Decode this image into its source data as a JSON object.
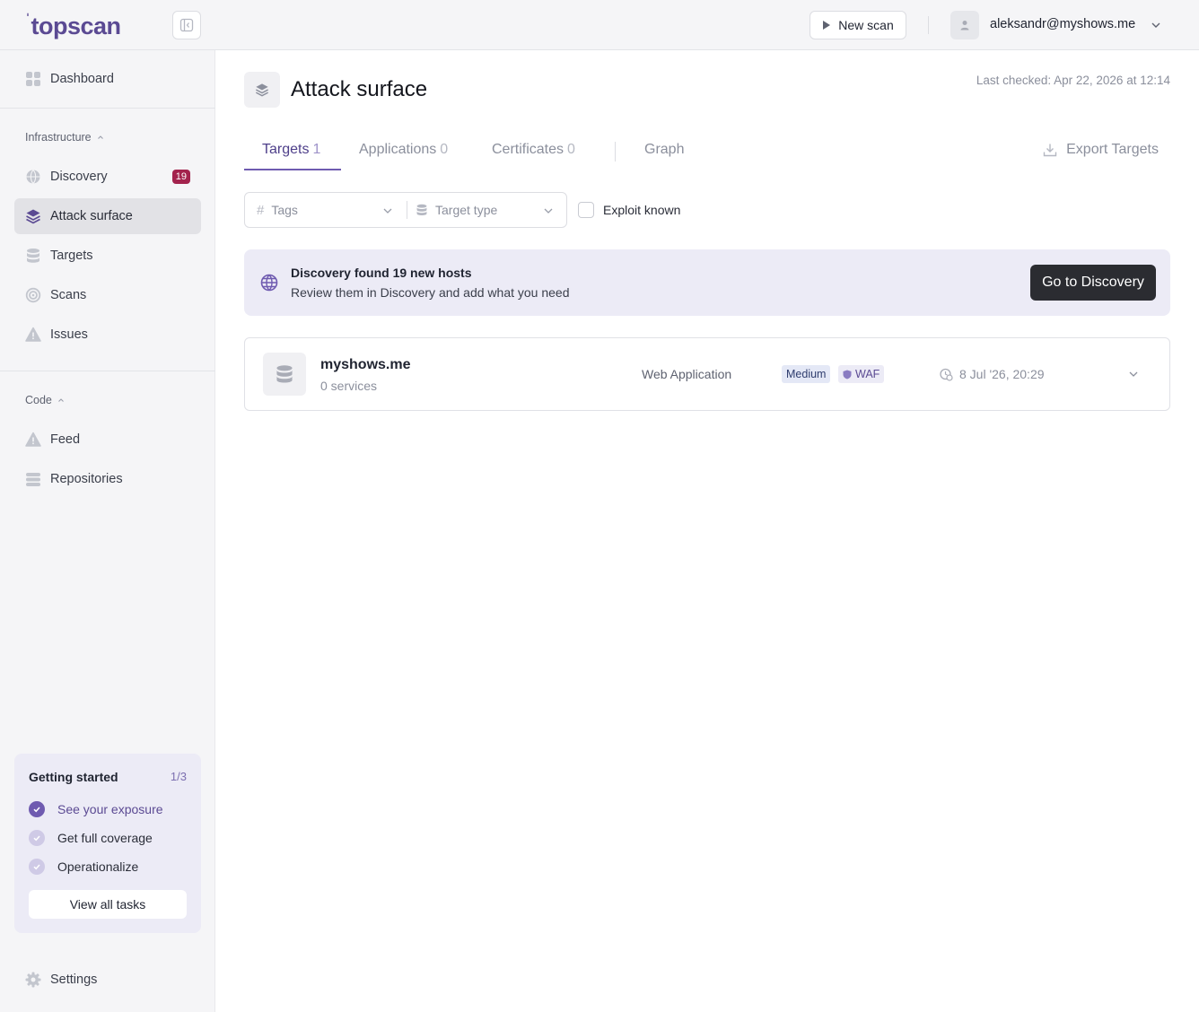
{
  "app": {
    "logo": "topscan",
    "brand_color": "#5b4a93"
  },
  "topbar": {
    "new_scan_label": "New scan",
    "user_email": "aleksandr@myshows.me"
  },
  "sidebar": {
    "dashboard": "Dashboard",
    "infrastructure_label": "Infrastructure",
    "infrastructure_items": [
      {
        "label": "Discovery",
        "icon": "globe-icon",
        "badge": "19"
      },
      {
        "label": "Attack surface",
        "icon": "layers-icon",
        "active": true
      },
      {
        "label": "Targets",
        "icon": "database-icon"
      },
      {
        "label": "Scans",
        "icon": "target-icon"
      },
      {
        "label": "Issues",
        "icon": "warning-icon"
      }
    ],
    "code_label": "Code",
    "code_items": [
      {
        "label": "Feed",
        "icon": "warning-icon"
      },
      {
        "label": "Repositories",
        "icon": "stack-icon"
      }
    ],
    "getting_started": {
      "title": "Getting started",
      "count": "1/3",
      "items": [
        {
          "label": "See your exposure",
          "done": true
        },
        {
          "label": "Get full coverage",
          "done": false
        },
        {
          "label": "Operationalize",
          "done": false
        }
      ],
      "button": "View all tasks"
    },
    "settings": "Settings"
  },
  "main": {
    "title": "Attack surface",
    "last_checked": "Last checked: Apr 22, 2026 at 12:14",
    "tabs": [
      {
        "label": "Targets",
        "count": "1",
        "active": true
      },
      {
        "label": "Applications",
        "count": "0"
      },
      {
        "label": "Certificates",
        "count": "0"
      },
      {
        "label": "Graph",
        "count": ""
      }
    ],
    "export_label": "Export Targets",
    "filters": {
      "tags_placeholder": "Tags",
      "target_type_placeholder": "Target type",
      "exploit_known_label": "Exploit known"
    },
    "banner": {
      "title": "Discovery found 19 new hosts",
      "subtitle": "Review them in Discovery and add what you need",
      "button": "Go to Discovery"
    },
    "targets": [
      {
        "name": "myshows.me",
        "services": "0 services",
        "type": "Web Application",
        "severity": "Medium",
        "waf": "WAF",
        "date": "8 Jul '26, 20:29"
      }
    ]
  }
}
